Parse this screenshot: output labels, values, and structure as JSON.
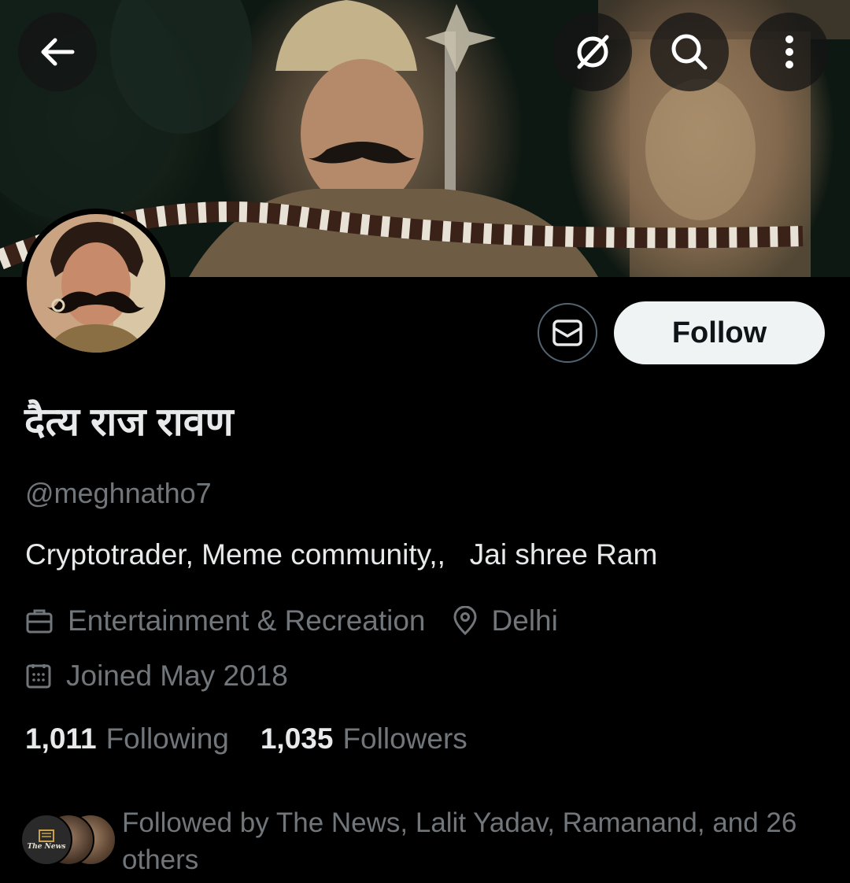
{
  "header": {
    "back_icon": "arrow-left-icon",
    "grok_icon": "slash-circle-icon",
    "search_icon": "search-icon",
    "more_icon": "more-vertical-icon"
  },
  "profile": {
    "display_name": "दैत्य राज रावण",
    "handle": "@meghnatho7",
    "bio": "Cryptotrader, Meme community,,   Jai shree Ram",
    "category": "Entertainment & Recreation",
    "location": "Delhi",
    "joined": "Joined May 2018",
    "following_count": "1,011",
    "following_label": "Following",
    "followers_count": "1,035",
    "followers_label": "Followers"
  },
  "actions": {
    "message_icon": "envelope-icon",
    "follow_label": "Follow"
  },
  "followed_by": {
    "text": "Followed by The News, Lalit Yadav, Ramanand, and 26 others",
    "first_avatar_label": "The News"
  },
  "colors": {
    "background": "#000000",
    "primary_text": "#e7e9ea",
    "secondary_text": "#71767b",
    "follow_button_bg": "#eff3f4",
    "border": "#536471"
  }
}
